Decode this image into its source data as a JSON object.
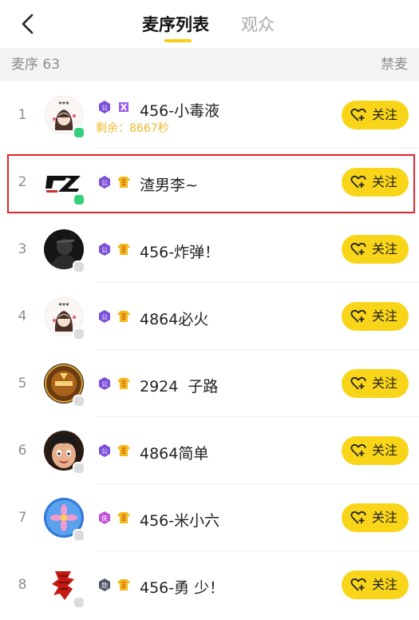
{
  "tabs": {
    "mic_list": "麦序列表",
    "audience": "观众"
  },
  "subbar": {
    "count_label": "麦序 63",
    "ban_label": "禁麦"
  },
  "follow_label": "关注",
  "colors": {
    "accent": "#f9d51a",
    "online": "#35d07a",
    "offline": "#dcdcdc",
    "countdown": "#f0b92f",
    "highlight": "#e0262b"
  },
  "items": [
    {
      "index": "1",
      "name": "456-小毒液",
      "badges": [
        "gong-badge",
        "double-x-badge"
      ],
      "countdown": "剩余：8667秒",
      "online": true,
      "selected": false
    },
    {
      "index": "2",
      "name": "渣男李~",
      "badges": [
        "gong-badge",
        "shirt-badge"
      ],
      "online": true,
      "selected": true
    },
    {
      "index": "3",
      "name": "456-炸弹！",
      "badges": [
        "gong-badge",
        "shirt-badge"
      ],
      "online": false,
      "selected": false
    },
    {
      "index": "4",
      "name": "4864必火",
      "badges": [
        "gong-badge",
        "shirt-badge"
      ],
      "online": false,
      "selected": false
    },
    {
      "index": "5",
      "name": "2924  子路",
      "badges": [
        "gong-badge",
        "shirt-badge"
      ],
      "online": false,
      "selected": false
    },
    {
      "index": "6",
      "name": "4864简单",
      "badges": [
        "gong-badge",
        "shirt-badge"
      ],
      "online": false,
      "selected": false
    },
    {
      "index": "7",
      "name": "456-米小六",
      "badges": [
        "hou-badge",
        "shirt-badge"
      ],
      "online": false,
      "selected": false
    },
    {
      "index": "8",
      "name": "456-勇 少！",
      "badges": [
        "xun-badge",
        "shirt-badge"
      ],
      "online": false,
      "selected": false
    }
  ]
}
